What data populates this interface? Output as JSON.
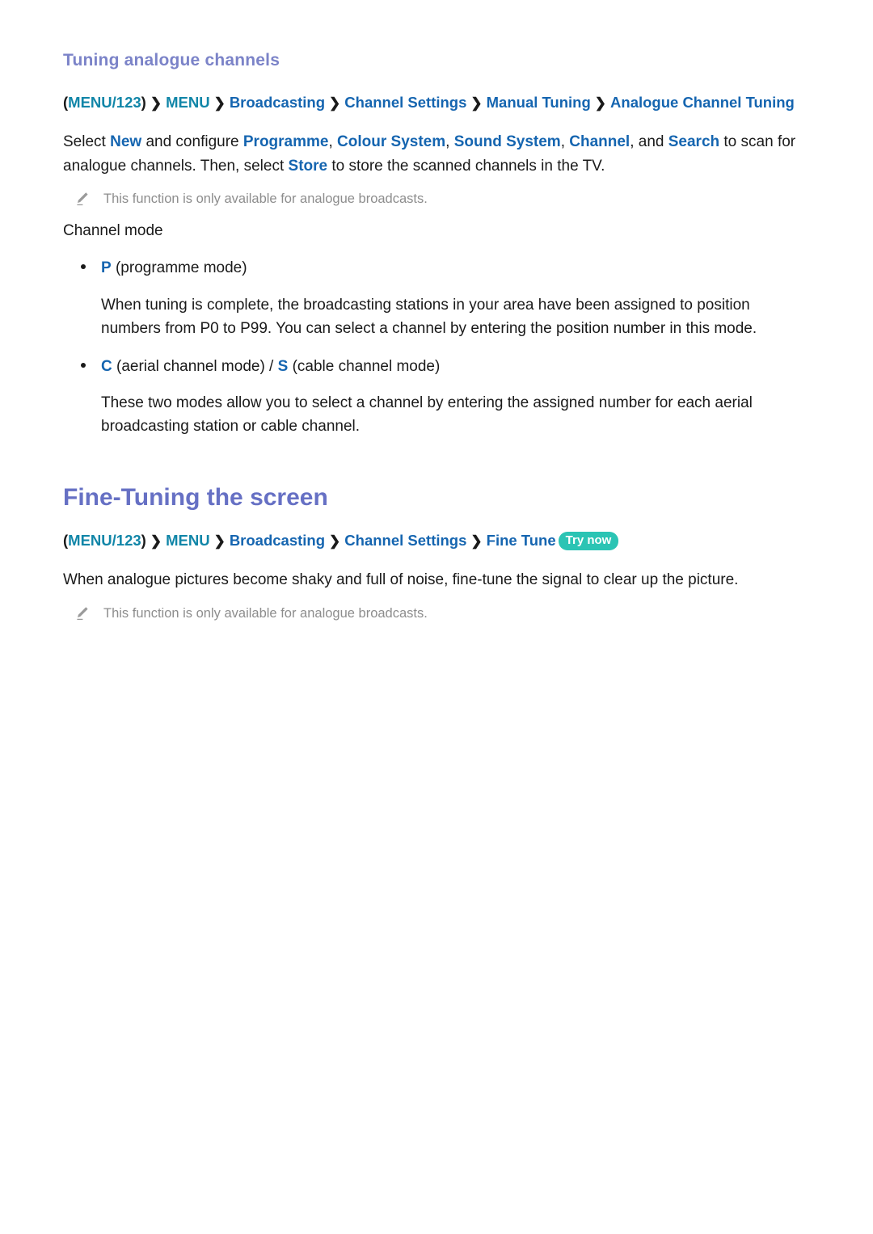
{
  "section_one": {
    "heading": "Tuning analogue channels",
    "breadcrumb": {
      "open_paren": "(",
      "menu123": "MENU/123",
      "close_paren": ")",
      "sep": "❯",
      "menu": "MENU",
      "items": [
        "Broadcasting",
        "Channel Settings",
        "Manual Tuning",
        "Analogue Channel Tuning"
      ]
    },
    "paragraph": {
      "t1": "Select ",
      "kw1": "New",
      "t2": " and configure ",
      "kw2": "Programme",
      "t3": ", ",
      "kw3": "Colour System",
      "t4": ", ",
      "kw4": "Sound System",
      "t5": ", ",
      "kw5": "Channel",
      "t6": ", and ",
      "kw6": "Search",
      "t7": " to scan for analogue channels. Then, select ",
      "kw7": "Store",
      "t8": " to store the scanned channels in the TV."
    },
    "note": "This function is only available for analogue broadcasts.",
    "channel_mode_label": "Channel mode",
    "bullets": [
      {
        "key": "P",
        "rest": " (programme mode)",
        "key2": "",
        "mid": "",
        "rest2": "",
        "description": "When tuning is complete, the broadcasting stations in your area have been assigned to position numbers from P0 to P99. You can select a channel by entering the position number in this mode."
      },
      {
        "key": "C",
        "rest": " (aerial channel mode) / ",
        "key2": "S",
        "mid": "",
        "rest2": " (cable channel mode)",
        "description": "These two modes allow you to select a channel by entering the assigned number for each aerial broadcasting station or cable channel."
      }
    ]
  },
  "section_two": {
    "heading": "Fine-Tuning the screen",
    "breadcrumb": {
      "open_paren": "(",
      "menu123": "MENU/123",
      "close_paren": ")",
      "sep": "❯",
      "menu": "MENU",
      "items": [
        "Broadcasting",
        "Channel Settings",
        "Fine Tune"
      ],
      "try_now": "Try now"
    },
    "paragraph": "When analogue pictures become shaky and full of noise, fine-tune the signal to clear up the picture.",
    "note": "This function is only available for analogue broadcasts."
  },
  "colors": {
    "heading_sub": "#7b83c8",
    "heading_main": "#6670c4",
    "breadcrumb_teal": "#1186a8",
    "breadcrumb_blue": "#1565b0",
    "keyword_blue": "#1565b0",
    "note_gray": "#8d8d8d",
    "try_now_bg": "#2bc4b4",
    "body": "#1a1a1a"
  }
}
